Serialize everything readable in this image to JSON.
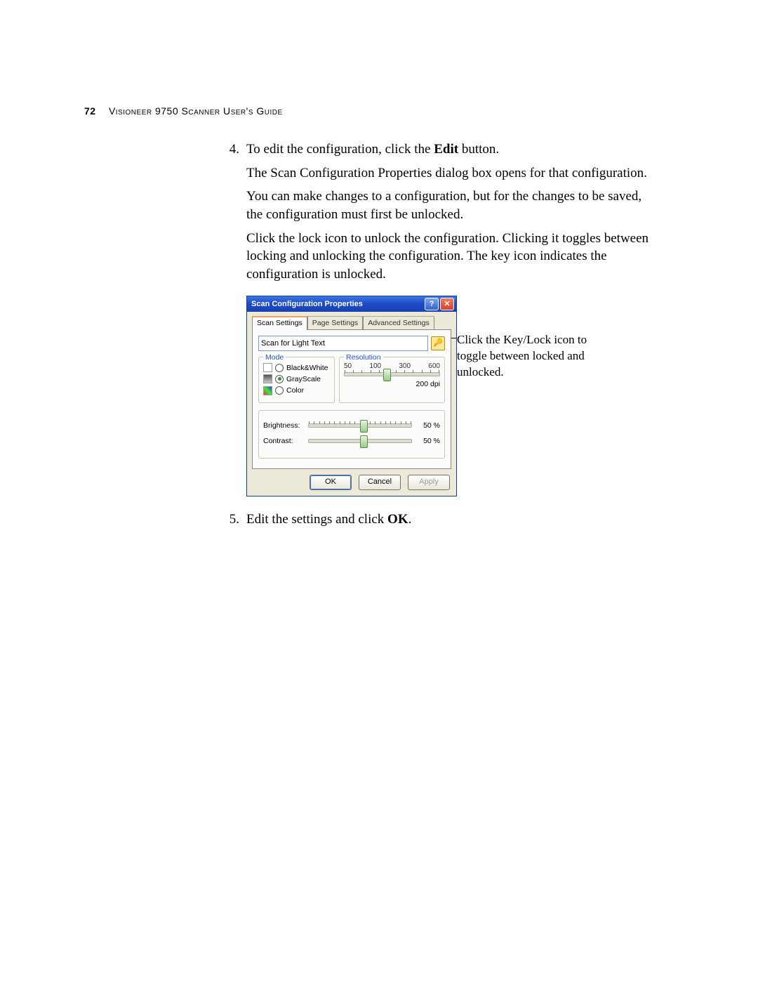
{
  "header": {
    "page_number": "72",
    "guide_title": "Visioneer 9750 Scanner User's Guide"
  },
  "steps": {
    "s4": {
      "num": "4.",
      "line1_a": "To edit the configuration, click the ",
      "line1_bold": "Edit",
      "line1_b": " button.",
      "para2": "The Scan Configuration Properties dialog box opens for that configuration.",
      "para3": "You can make changes to a configuration, but for the changes to be saved, the configuration must first be unlocked.",
      "para4": "Click the lock icon to unlock the configuration. Clicking it toggles between locking and unlocking the configuration. The key icon indicates the configuration is unlocked."
    },
    "s5": {
      "num": "5.",
      "line_a": "Edit the settings and click ",
      "line_bold": "OK",
      "line_b": "."
    }
  },
  "dialog": {
    "title": "Scan Configuration Properties",
    "help_glyph": "?",
    "close_glyph": "✕",
    "tabs": {
      "scan": "Scan Settings",
      "page": "Page Settings",
      "adv": "Advanced Settings"
    },
    "config_name": "Scan for Light Text",
    "mode": {
      "legend": "Mode",
      "bw": "Black&White",
      "gray": "GrayScale",
      "color": "Color",
      "selected": "gray"
    },
    "resolution": {
      "legend": "Resolution",
      "ticks": [
        "50",
        "100",
        "300",
        "600"
      ],
      "value_label": "200 dpi",
      "value_pos_pct": 41
    },
    "brightness": {
      "label": "Brightness:",
      "value": "50 %",
      "pos_pct": 50
    },
    "contrast": {
      "label": "Contrast:",
      "value": "50 %",
      "pos_pct": 50
    },
    "buttons": {
      "ok": "OK",
      "cancel": "Cancel",
      "apply": "Apply"
    }
  },
  "callout": {
    "text": "Click the Key/Lock icon to toggle between locked and unlocked."
  }
}
